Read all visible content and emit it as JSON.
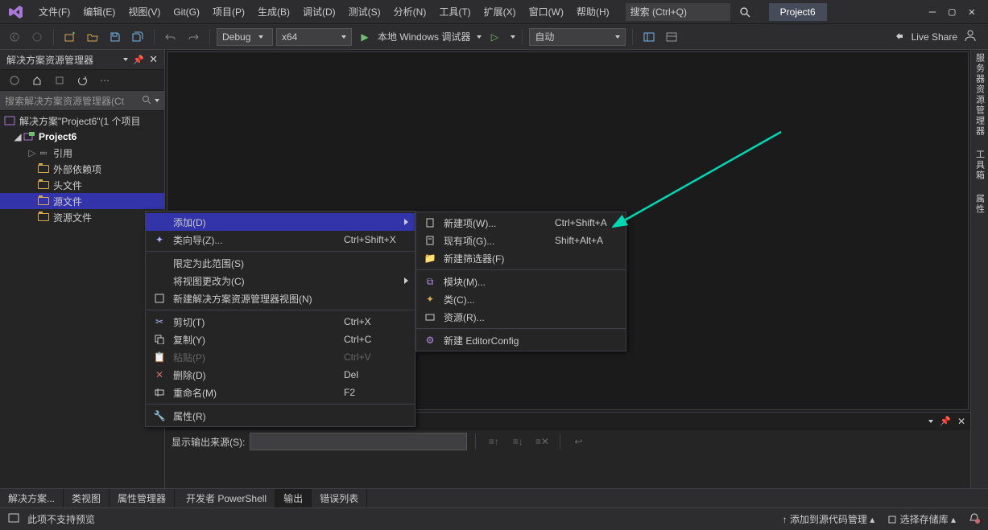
{
  "titlebar": {
    "menus": [
      "文件(F)",
      "编辑(E)",
      "视图(V)",
      "Git(G)",
      "项目(P)",
      "生成(B)",
      "调试(D)",
      "测试(S)",
      "分析(N)",
      "工具(T)",
      "扩展(X)",
      "窗口(W)",
      "帮助(H)"
    ],
    "search_placeholder": "搜索 (Ctrl+Q)",
    "project": "Project6"
  },
  "toolbar": {
    "config": "Debug",
    "platform": "x64",
    "debugger": "本地 Windows 调试器",
    "auto": "自动",
    "liveshare": "Live Share"
  },
  "solution_panel": {
    "title": "解决方案资源管理器",
    "search_placeholder": "搜索解决方案资源管理器(Ct",
    "root": "解决方案\"Project6\"(1 个项目",
    "project": "Project6",
    "nodes": [
      "引用",
      "外部依赖项",
      "头文件",
      "源文件",
      "资源文件"
    ]
  },
  "context1": {
    "add": "添加(D)",
    "class_wizard": "类向导(Z)...",
    "class_wizard_sc": "Ctrl+Shift+X",
    "scope": "限定为此范围(S)",
    "change_view": "将视图更改为(C)",
    "new_view": "新建解决方案资源管理器视图(N)",
    "cut": "剪切(T)",
    "cut_sc": "Ctrl+X",
    "copy": "复制(Y)",
    "copy_sc": "Ctrl+C",
    "paste": "粘贴(P)",
    "paste_sc": "Ctrl+V",
    "delete": "删除(D)",
    "del_sc": "Del",
    "rename": "重命名(M)",
    "rename_sc": "F2",
    "props": "属性(R)"
  },
  "context2": {
    "new_item": "新建项(W)...",
    "new_item_sc": "Ctrl+Shift+A",
    "existing": "现有项(G)...",
    "existing_sc": "Shift+Alt+A",
    "filter": "新建筛选器(F)",
    "module": "模块(M)...",
    "class": "类(C)...",
    "resource": "资源(R)...",
    "editorconfig": "新建 EditorConfig"
  },
  "right_rail": {
    "server": "服务器资源管理器",
    "toolbox": "工具箱",
    "props": "属性"
  },
  "output": {
    "panel_title": "输出",
    "label": "显示输出来源(S):"
  },
  "bottom_tabs": [
    "解决方案...",
    "类视图",
    "属性管理器",
    "开发者 PowerShell",
    "输出",
    "错误列表"
  ],
  "status": {
    "preview": "此项不支持预览",
    "add_src": "添加到源代码管理",
    "repo": "选择存储库"
  }
}
